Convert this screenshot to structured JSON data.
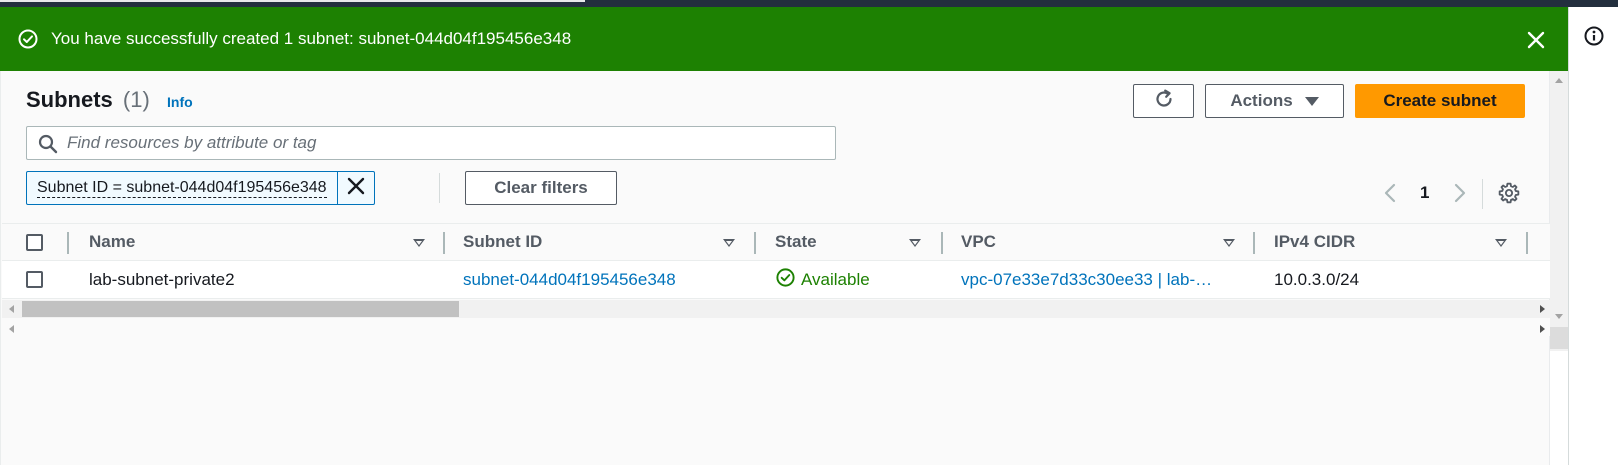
{
  "flash": {
    "message": "You have successfully created 1 subnet: subnet-044d04f195456e348",
    "type": "success",
    "icon": "check-circle-icon",
    "close_icon": "close-icon",
    "color": "#1d8102"
  },
  "header": {
    "title": "Subnets",
    "count": "(1)",
    "info_label": "Info",
    "refresh_icon": "refresh-icon",
    "actions_label": "Actions",
    "create_label": "Create subnet",
    "primary_color": "#ff9900"
  },
  "search": {
    "placeholder": "Find resources by attribute or tag",
    "value": ""
  },
  "filters": {
    "tokens": [
      {
        "label": "Subnet ID = subnet-044d04f195456e348"
      }
    ],
    "clear_label": "Clear filters"
  },
  "pagination": {
    "current_page": "1",
    "prev_icon": "chevron-left-icon",
    "next_icon": "chevron-right-icon",
    "settings_icon": "gear-icon"
  },
  "table": {
    "columns": [
      "Name",
      "Subnet ID",
      "State",
      "VPC",
      "IPv4 CIDR"
    ],
    "rows": [
      {
        "name": "lab-subnet-private2",
        "subnet_id": "subnet-044d04f195456e348",
        "state": "Available",
        "state_icon": "check-circle-icon",
        "vpc": "vpc-07e33e7d33c30ee33 | lab-…",
        "ipv4_cidr": "10.0.3.0/24"
      }
    ]
  },
  "colors": {
    "link": "#0073bb",
    "available": "#1d8102"
  }
}
